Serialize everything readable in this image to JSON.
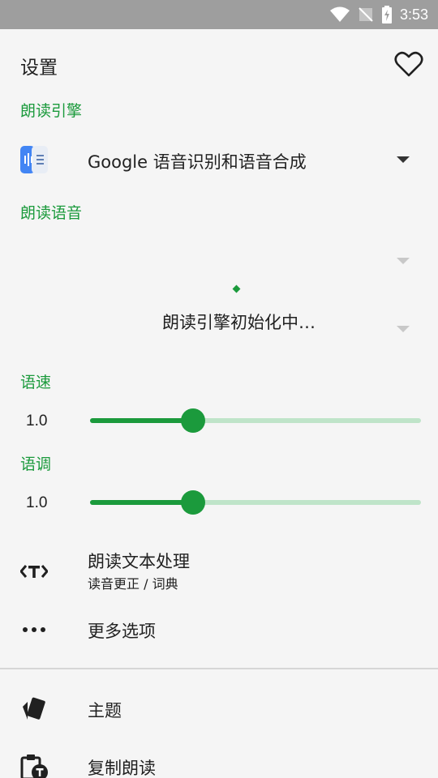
{
  "status_bar": {
    "time": "3:53"
  },
  "header": {
    "title": "设置"
  },
  "engine": {
    "section_label": "朗读引擎",
    "selected": "Google 语音识别和语音合成"
  },
  "voice": {
    "section_label": "朗读语音",
    "loading_text": "朗读引擎初始化中…"
  },
  "speed": {
    "section_label": "语速",
    "value_text": "1.0",
    "value": 1.0,
    "range": [
      0.1,
      3.0
    ]
  },
  "pitch": {
    "section_label": "语调",
    "value_text": "1.0",
    "value": 1.0,
    "range": [
      0.1,
      3.0
    ]
  },
  "items": {
    "text_processing": {
      "label": "朗读文本处理",
      "sub": "读音更正 / 词典"
    },
    "more_options": {
      "label": "更多选项"
    },
    "theme": {
      "label": "主题"
    },
    "copy_read": {
      "label": "复制朗读"
    }
  },
  "colors": {
    "accent": "#1b9a3c",
    "track": "#bfe4c9",
    "status_bar": "#9e9e9e"
  }
}
